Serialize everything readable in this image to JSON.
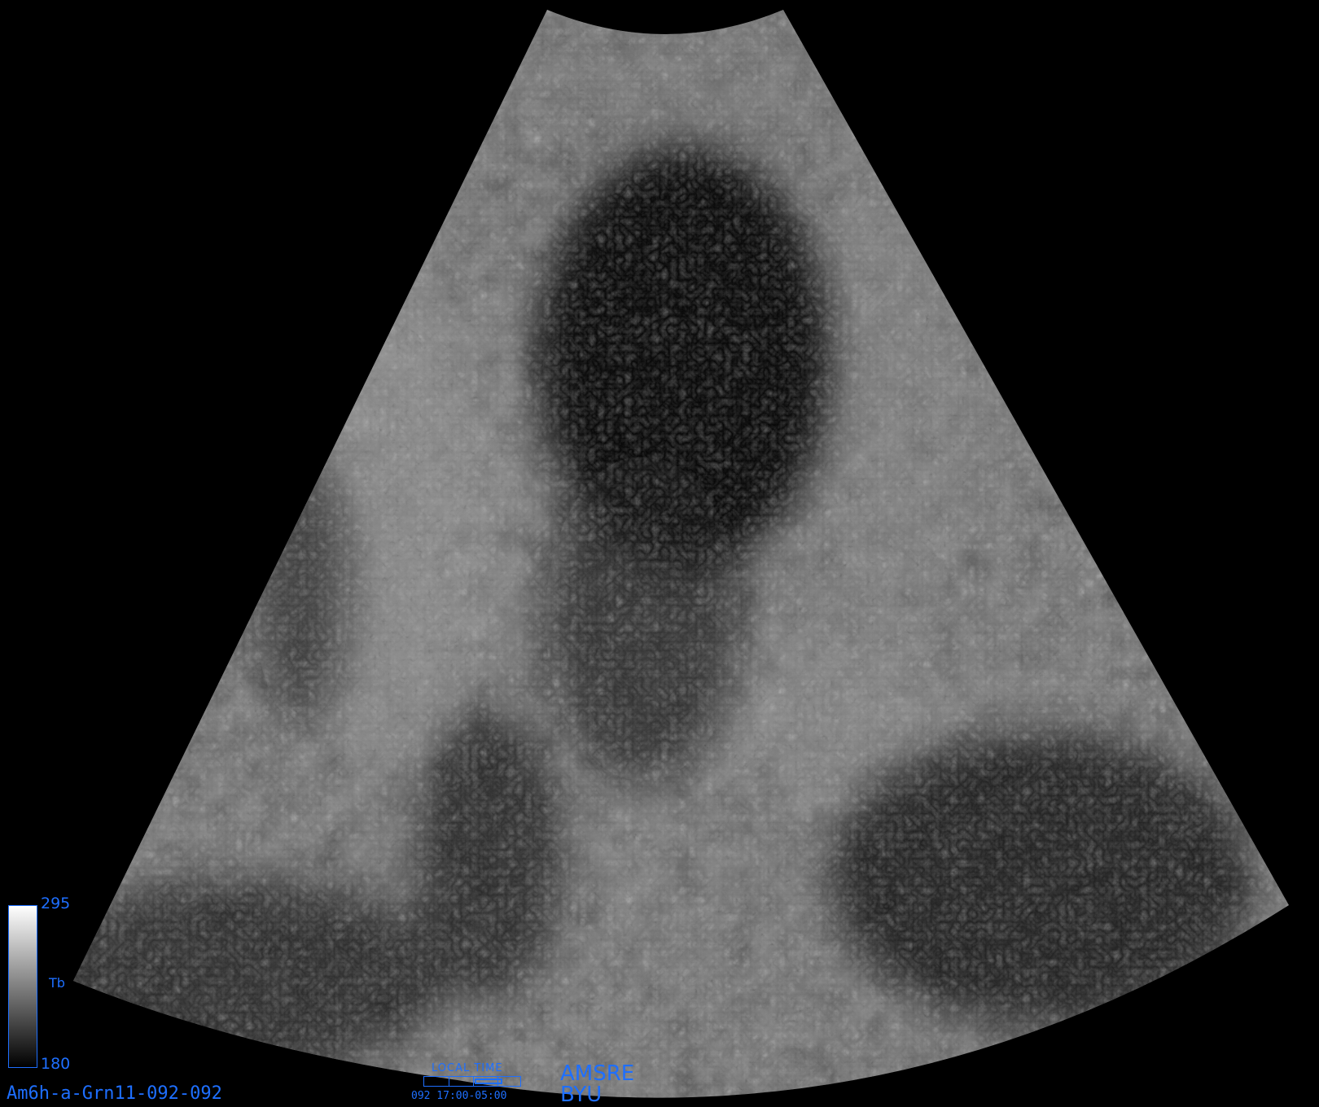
{
  "colorbar": {
    "max": "295",
    "min": "180",
    "label": "Tb",
    "colors": [
      "#ffffff",
      "#000000"
    ]
  },
  "product_id": "Am6h-a-Grn11-092-092",
  "local_time": {
    "title": "LOCAL  TIME",
    "text": "092  17:00-05:00"
  },
  "sensor": "AMSRE",
  "organization": "BYU",
  "label_color": "#1e6fff"
}
